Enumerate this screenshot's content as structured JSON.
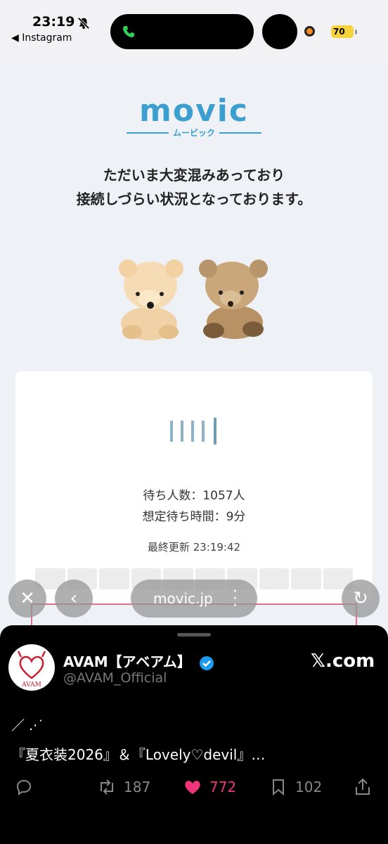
{
  "status_bar": {
    "time": "23:19",
    "back_label": "◀ Instagram",
    "battery": "70"
  },
  "page": {
    "logo_main": "movic",
    "logo_sub": "ムービック",
    "message_line1": "ただいま大変混みあっており",
    "message_line2": "接続しづらい状況となっております。",
    "waiting_count": "待ち人数：1057人",
    "waiting_time": "想定待ち時間：9分",
    "last_updated": "最終更新 23:19:42"
  },
  "browser": {
    "close_label": "✕",
    "back_label": "‹",
    "url": "movic.jp",
    "reload_label": "↻"
  },
  "tweet": {
    "author": "AVAM【アベアム】",
    "handle": "@AVAM_Official",
    "source": "𝕏.com",
    "line1": "／ .·˙",
    "line2": "『夏衣装2026』＆『Lovely♡devil』…",
    "retweets": "187",
    "likes": "772",
    "bookmarks": "102"
  },
  "colors": {
    "movic_blue": "#3d9fd0",
    "like_pink": "#f0347a",
    "battery_yellow": "#f5d33b"
  },
  "icons": [
    "bell-muted-icon",
    "phone-icon",
    "close-icon",
    "chevron-left-icon",
    "more-vertical-icon",
    "reload-icon",
    "verified-icon",
    "reply-icon",
    "retweet-icon",
    "heart-icon",
    "bookmark-icon",
    "share-icon"
  ]
}
